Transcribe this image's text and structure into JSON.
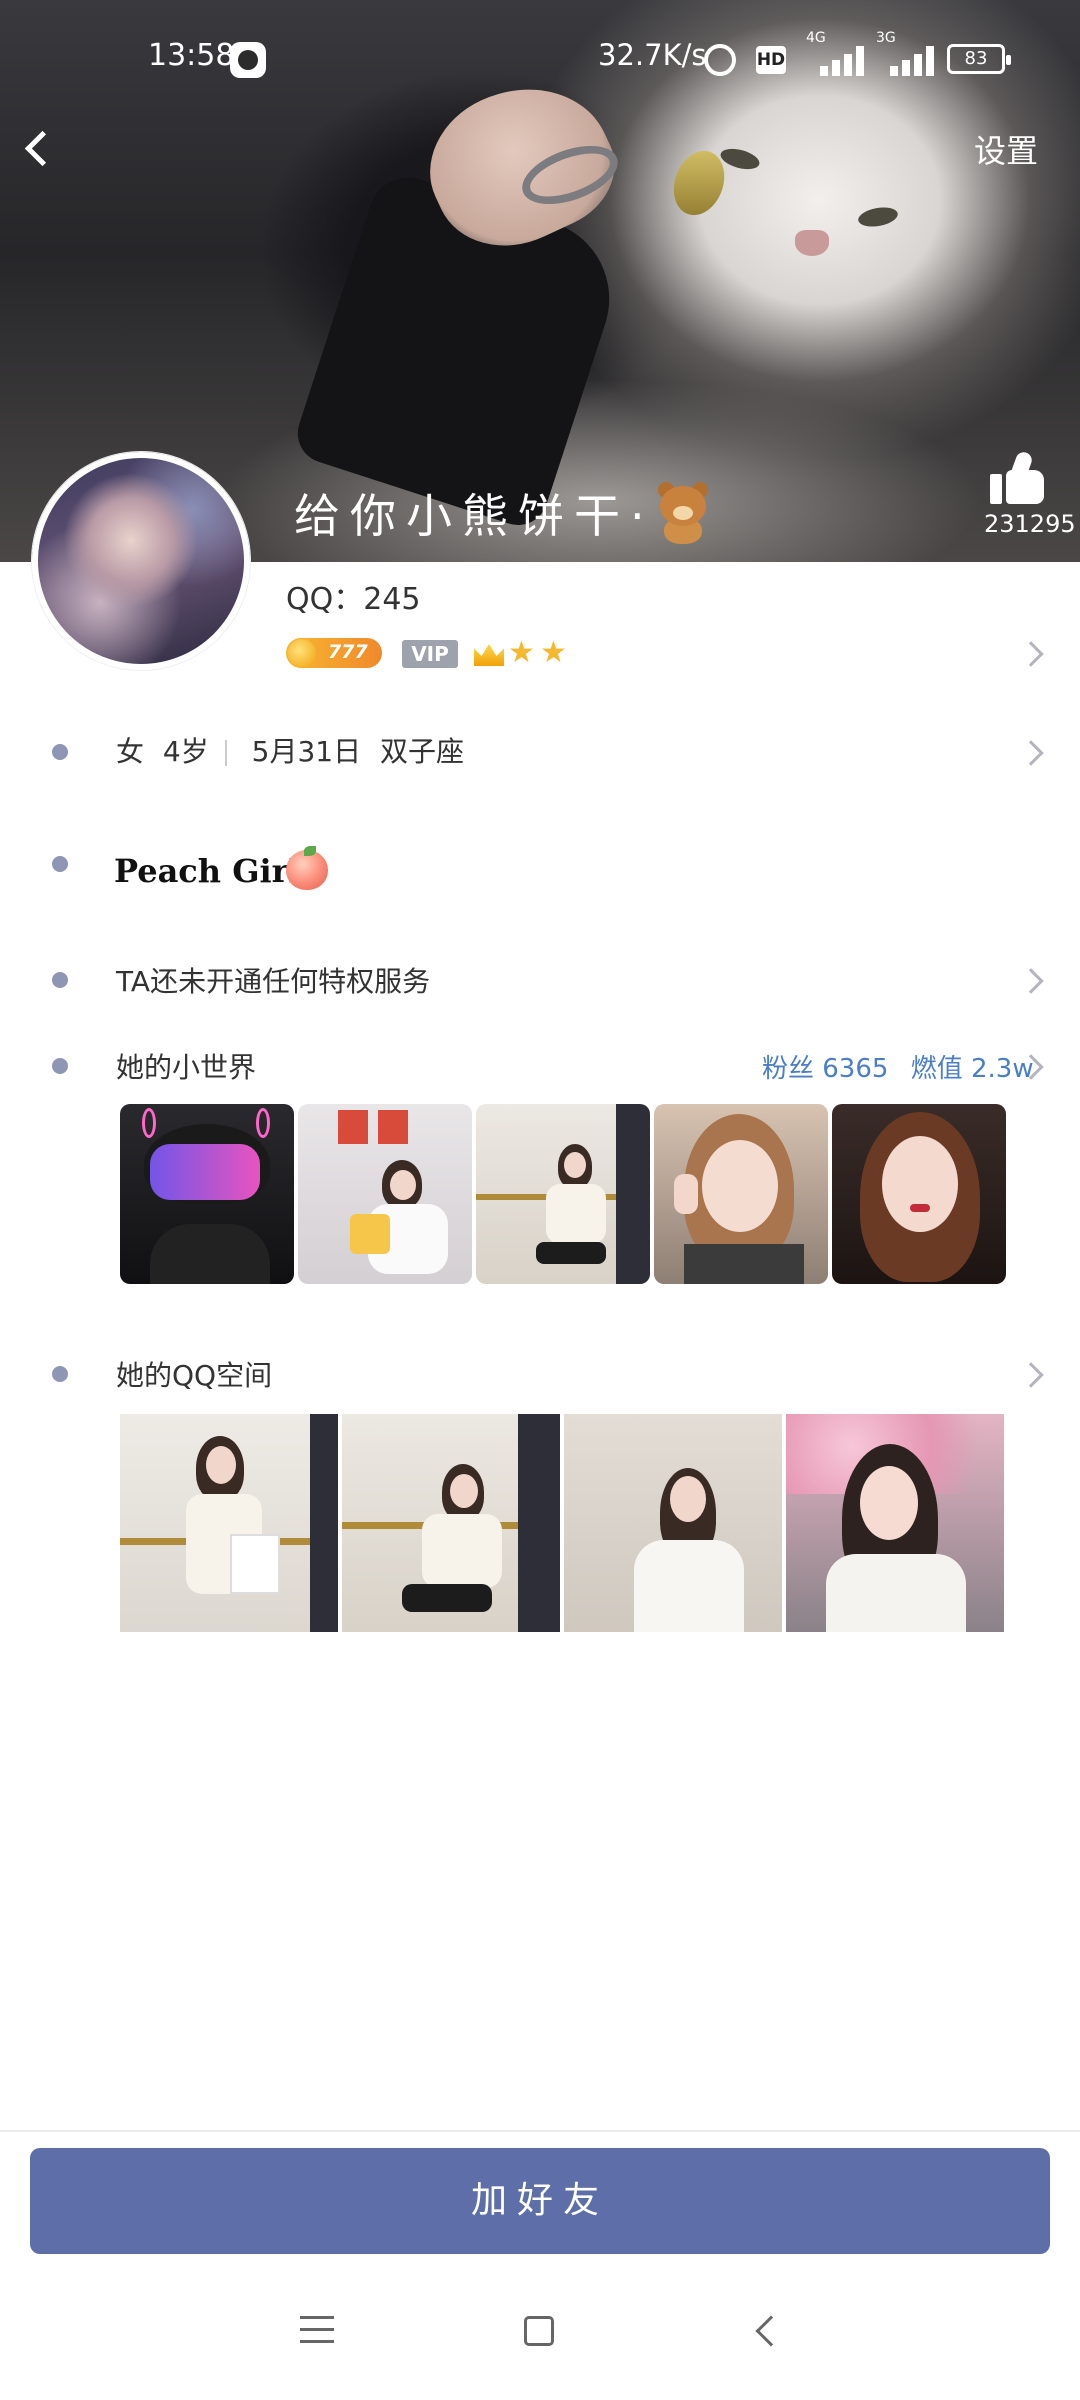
{
  "status_bar": {
    "time": "13:58",
    "net_speed": "32.7K/s",
    "hd_label": "HD",
    "net1": "4G",
    "net2": "3G",
    "battery": "83"
  },
  "header": {
    "back_icon": "chevron-left-icon",
    "settings_label": "设置"
  },
  "profile": {
    "nickname": "给你小熊饼干·",
    "nickname_emoji": "bear-emoji",
    "like_count": "231295",
    "qq_label": "QQ：245",
    "level_badge": "777",
    "vip_label": "VIP",
    "info": {
      "gender": "女",
      "age": "4岁",
      "birthday": "5月31日",
      "zodiac": "双子座"
    },
    "signature": "Peach Girl·",
    "signature_emoji": "peach-emoji",
    "privilege_text": "TA还未开通任何特权服务"
  },
  "small_world": {
    "title": "她的小世界",
    "fans_label": "粉丝 6365",
    "heat_label": "燃值 2.3w",
    "photos": [
      "photo-1",
      "photo-2",
      "photo-3",
      "photo-4",
      "photo-5"
    ]
  },
  "qzone": {
    "title": "她的QQ空间",
    "photos": [
      "photo-1",
      "photo-2",
      "photo-3",
      "photo-4"
    ]
  },
  "actions": {
    "add_friend_label": "加好友"
  },
  "colors": {
    "accent": "#5e6ea8",
    "bullet": "#8f96b4",
    "link": "#4a7ec8"
  }
}
